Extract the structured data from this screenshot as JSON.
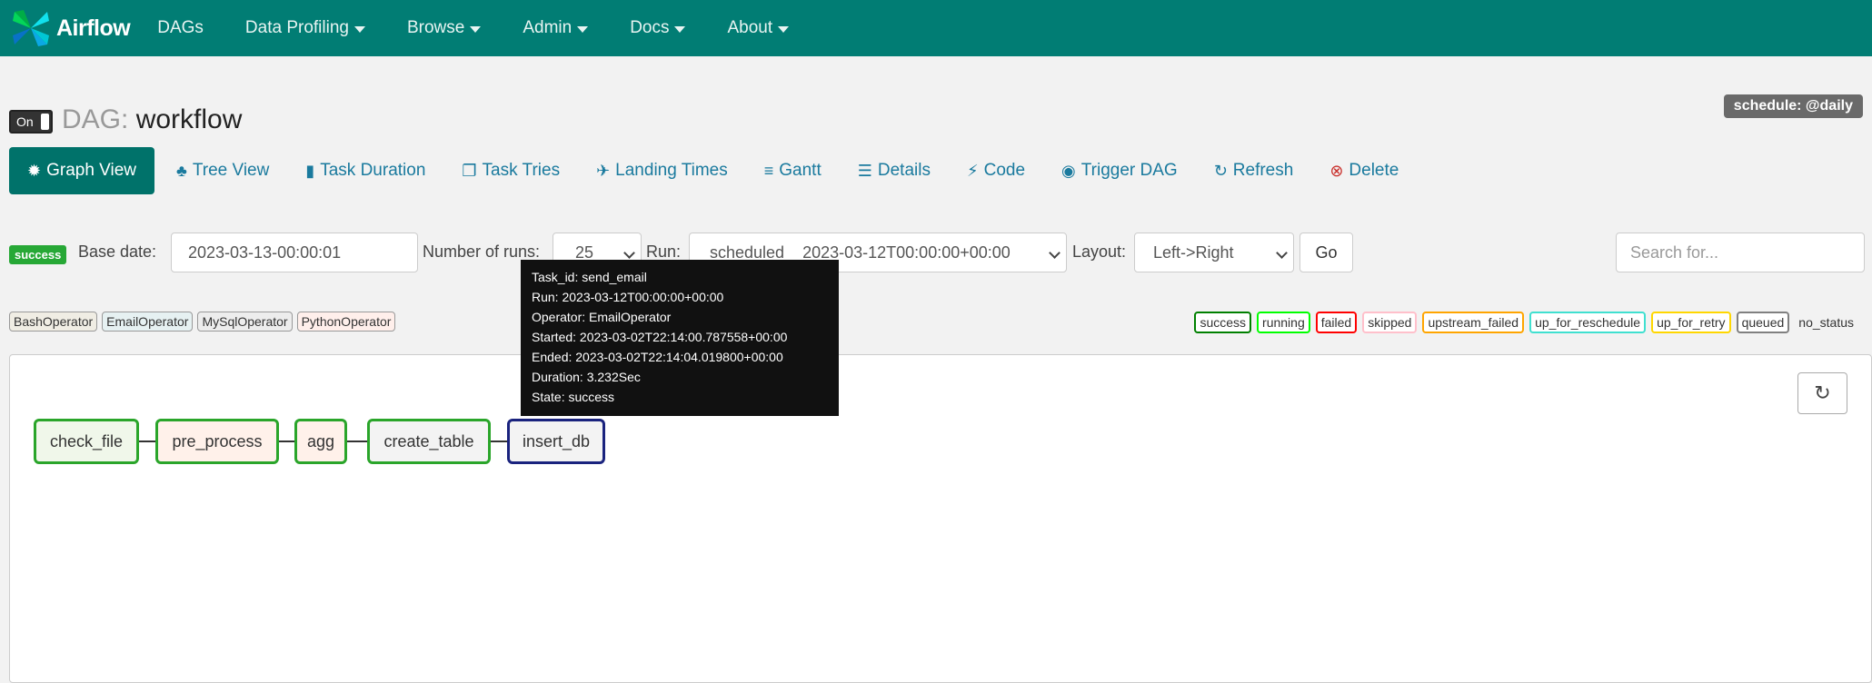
{
  "nav": {
    "brand": "Airflow",
    "items": [
      {
        "label": "DAGs",
        "dropdown": false
      },
      {
        "label": "Data Profiling",
        "dropdown": true
      },
      {
        "label": "Browse",
        "dropdown": true
      },
      {
        "label": "Admin",
        "dropdown": true
      },
      {
        "label": "Docs",
        "dropdown": true
      },
      {
        "label": "About",
        "dropdown": true
      }
    ]
  },
  "header": {
    "toggle_label": "On",
    "dag_prefix": "DAG:",
    "dag_name": "workflow",
    "schedule": "schedule: @daily"
  },
  "tabs": [
    {
      "label": "Graph View",
      "icon": "asterisk-icon",
      "glyph": "✹",
      "active": true
    },
    {
      "label": "Tree View",
      "icon": "tree-icon",
      "glyph": "♣"
    },
    {
      "label": "Task Duration",
      "icon": "bar-chart-icon",
      "glyph": "▮"
    },
    {
      "label": "Task Tries",
      "icon": "duplicate-icon",
      "glyph": "❐"
    },
    {
      "label": "Landing Times",
      "icon": "plane-icon",
      "glyph": "✈"
    },
    {
      "label": "Gantt",
      "icon": "gantt-icon",
      "glyph": "≡"
    },
    {
      "label": "Details",
      "icon": "list-icon",
      "glyph": "☰"
    },
    {
      "label": "Code",
      "icon": "flash-icon",
      "glyph": "⚡"
    },
    {
      "label": "Trigger DAG",
      "icon": "play-circle-icon",
      "glyph": "◉"
    },
    {
      "label": "Refresh",
      "icon": "refresh-icon",
      "glyph": "↻"
    },
    {
      "label": "Delete",
      "icon": "remove-circle-icon",
      "glyph": "⊗"
    }
  ],
  "form": {
    "status": "success",
    "base_date_label": "Base date:",
    "base_date_value": "2023-03-13-00:00:01",
    "num_runs_label": "Number of runs:",
    "num_runs_value": "25",
    "run_label": "Run:",
    "run_value": "scheduled__2023-03-12T00:00:00+00:00",
    "layout_label": "Layout:",
    "layout_value": "Left->Right",
    "go_label": "Go",
    "search_placeholder": "Search for..."
  },
  "operators": [
    {
      "label": "BashOperator",
      "bg": "#f0ede4"
    },
    {
      "label": "EmailOperator",
      "bg": "#e6f1f2"
    },
    {
      "label": "MySqlOperator",
      "bg": "#ededed"
    },
    {
      "label": "PythonOperator",
      "bg": "#ffefeb"
    }
  ],
  "states": [
    {
      "label": "success",
      "color": "#008000"
    },
    {
      "label": "running",
      "color": "#00ff00"
    },
    {
      "label": "failed",
      "color": "#ff0000"
    },
    {
      "label": "skipped",
      "color": "#ffc0cb"
    },
    {
      "label": "upstream_failed",
      "color": "#ffa500"
    },
    {
      "label": "up_for_reschedule",
      "color": "#40e0d0"
    },
    {
      "label": "up_for_retry",
      "color": "#ffd700"
    },
    {
      "label": "queued",
      "color": "#808080"
    },
    {
      "label": "no_status",
      "color": "none"
    }
  ],
  "graph": {
    "nodes": [
      {
        "label": "check_file",
        "border": "#2aa52a",
        "bg": "#f0f7ea"
      },
      {
        "label": "pre_process",
        "border": "#2aa52a",
        "bg": "#fff1ea"
      },
      {
        "label": "agg",
        "border": "#2aa52a",
        "bg": "#fff1ea"
      },
      {
        "label": "create_table",
        "border": "#2aa52a",
        "bg": "#f3f3f3"
      },
      {
        "label": "insert_db",
        "border": "#1a237e",
        "bg": "#f3f3f3"
      }
    ]
  },
  "tooltip": {
    "lines": [
      "Task_id: send_email",
      "Run: 2023-03-12T00:00:00+00:00",
      "Operator: EmailOperator",
      "Started: 2023-03-02T22:14:00.787558+00:00",
      "Ended: 2023-03-02T22:14:04.019800+00:00",
      "Duration: 3.232Sec",
      "State: success"
    ]
  }
}
